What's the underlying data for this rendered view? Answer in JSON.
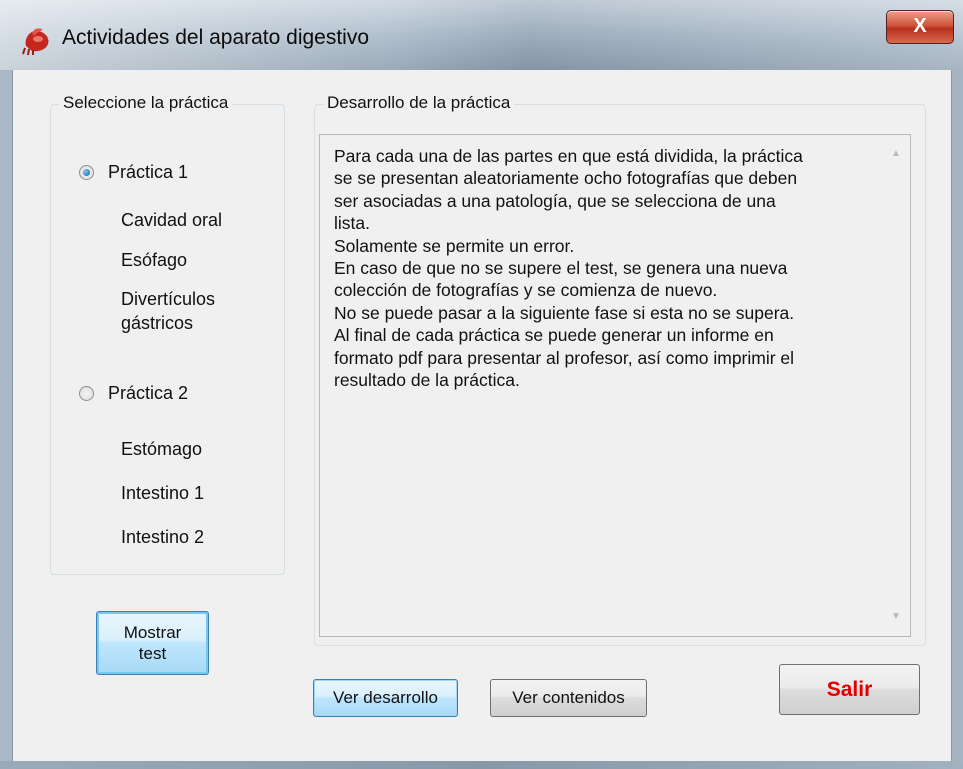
{
  "window": {
    "title": "Actividades del aparato digestivo",
    "close_label": "X"
  },
  "left_group": {
    "legend": "Seleccione la práctica",
    "practica1": {
      "label": "Práctica 1",
      "selected": true,
      "items": [
        "Cavidad oral",
        "Esófago",
        "Divertículos gástricos"
      ]
    },
    "practica2": {
      "label": "Práctica 2",
      "selected": false,
      "items": [
        "Estómago",
        "Intestino 1",
        "Intestino 2"
      ]
    }
  },
  "right_group": {
    "legend": "Desarrollo de la práctica",
    "text": "Para cada una de las partes en que está dividida, la práctica\nse se presentan aleatoriamente ocho fotografías que deben\nser asociadas a una patología, que se selecciona de una\nlista.\nSolamente se permite un error.\nEn caso de que no se supere el test, se genera una nueva\ncolección de fotografías y se comienza de nuevo.\nNo se puede pasar a la siguiente fase si esta no se supera.\nAl final de cada práctica se puede generar un informe en\nformato pdf para presentar al profesor, así como imprimir el\nresultado de la práctica."
  },
  "buttons": {
    "mostrar_test": "Mostrar\ntest",
    "ver_desarrollo": "Ver desarrollo",
    "ver_contenidos": "Ver contenidos",
    "salir": "Salir"
  },
  "colors": {
    "salir_text": "#e00000",
    "radio_selected": "#1d6fb3",
    "client_background": "#f0f0f0"
  }
}
